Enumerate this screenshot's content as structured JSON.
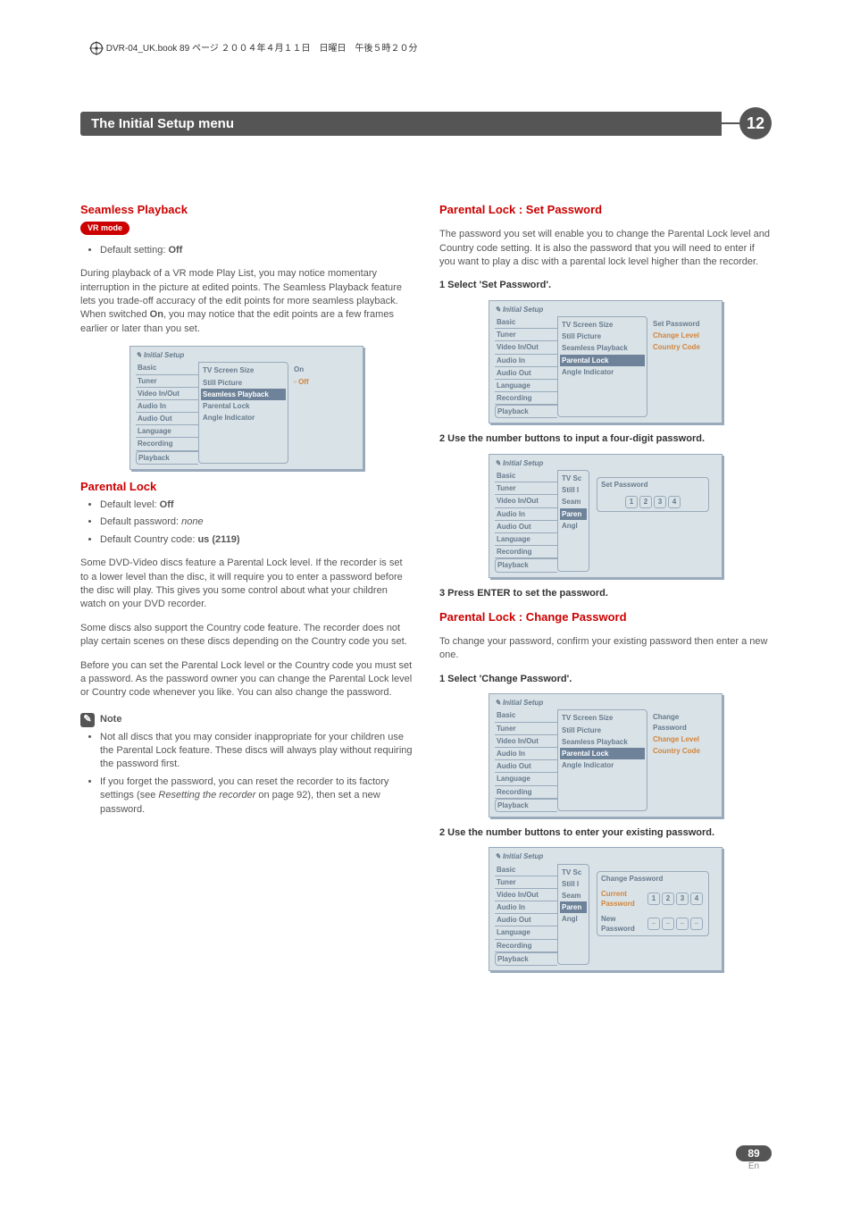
{
  "header_line": "DVR-04_UK.book 89 ページ ２００４年４月１１日　日曜日　午後５時２０分",
  "chapter": {
    "title": "The Initial Setup menu",
    "number": "12"
  },
  "left": {
    "sec1_title": "Seamless Playback",
    "pill": "VR mode",
    "bullet_default": "Default setting:",
    "bullet_default_val": "Off",
    "p1": "During playback of a VR mode Play List, you may notice momentary interruption in the picture at edited points. The Seamless Playback feature lets you trade-off accuracy of the edit points for more seamless playback. When switched ",
    "p1_on": "On",
    "p1b": ", you may notice that the edit points are a few frames earlier or later than you set.",
    "sec2_title": "Parental Lock",
    "b2a": "Default level:",
    "b2a_val": "Off",
    "b2b": "Default password:",
    "b2b_val": "none",
    "b2c": "Default Country code:",
    "b2c_val": "us (2119)",
    "p2": "Some DVD-Video discs feature a Parental Lock level. If the recorder is set to a lower level than the disc, it will require you to enter a password before the disc will play. This gives you some control about what your children watch on your DVD recorder.",
    "p3": "Some discs also support the Country code feature. The recorder does not play certain scenes on these discs depending on the Country code you set.",
    "p4": "Before you can set the Parental Lock level or the Country code you must set a password. As the password owner you can change the Parental Lock level or Country code whenever you like. You can also change the password.",
    "note_label": "Note",
    "note1": "Not all discs that you may consider inappropriate for your children use the Parental Lock feature. These discs will always play without requiring the password first.",
    "note2a": "If you forget the password, you can reset the recorder to its factory settings (see ",
    "note2b": "Resetting the recorder",
    "note2c": " on page 92), then set a new password."
  },
  "right": {
    "sec1_title": "Parental Lock : Set Password",
    "p1": "The password you set will enable you to change the Parental Lock level and Country code setting. It is also the password that you will need to enter if you want to play a disc with a parental lock level higher than the recorder.",
    "step1": "1   Select 'Set Password'.",
    "step2": "2   Use the number buttons to input a four-digit password.",
    "step3": "3   Press ENTER to set the password.",
    "sec2_title": "Parental Lock : Change Password",
    "p2": "To change your password, confirm your existing password then enter a new one.",
    "step4": "1   Select 'Change Password'.",
    "step5": "2   Use the number buttons to enter your existing password."
  },
  "menu": {
    "title": "Initial Setup",
    "left_items": [
      "Basic",
      "Tuner",
      "Video In/Out",
      "Audio In",
      "Audio Out",
      "Language",
      "Recording",
      "Playback"
    ],
    "mid_items": [
      "TV Screen Size",
      "Still Picture",
      "Seamless Playback",
      "Parental Lock",
      "Angle Indicator"
    ],
    "mid_short": [
      "TV Sc",
      "Still I",
      "Seam",
      "Paren",
      "Angl"
    ],
    "seamless_opts": {
      "on": "On",
      "off": "Off"
    },
    "set_pw_opts": [
      "Set Password",
      "Change Level",
      "Country Code"
    ],
    "change_pw_opts": [
      "Change Password",
      "Change Level",
      "Country Code"
    ],
    "dlg_set": "Set Password",
    "dlg_change": "Change Password",
    "dlg_cur": "Current Password",
    "dlg_new": "New Password",
    "pin": [
      "1",
      "2",
      "3",
      "4"
    ],
    "pin_empty": [
      "–",
      "–",
      "–",
      "–"
    ]
  },
  "page": {
    "num": "89",
    "lang": "En"
  }
}
